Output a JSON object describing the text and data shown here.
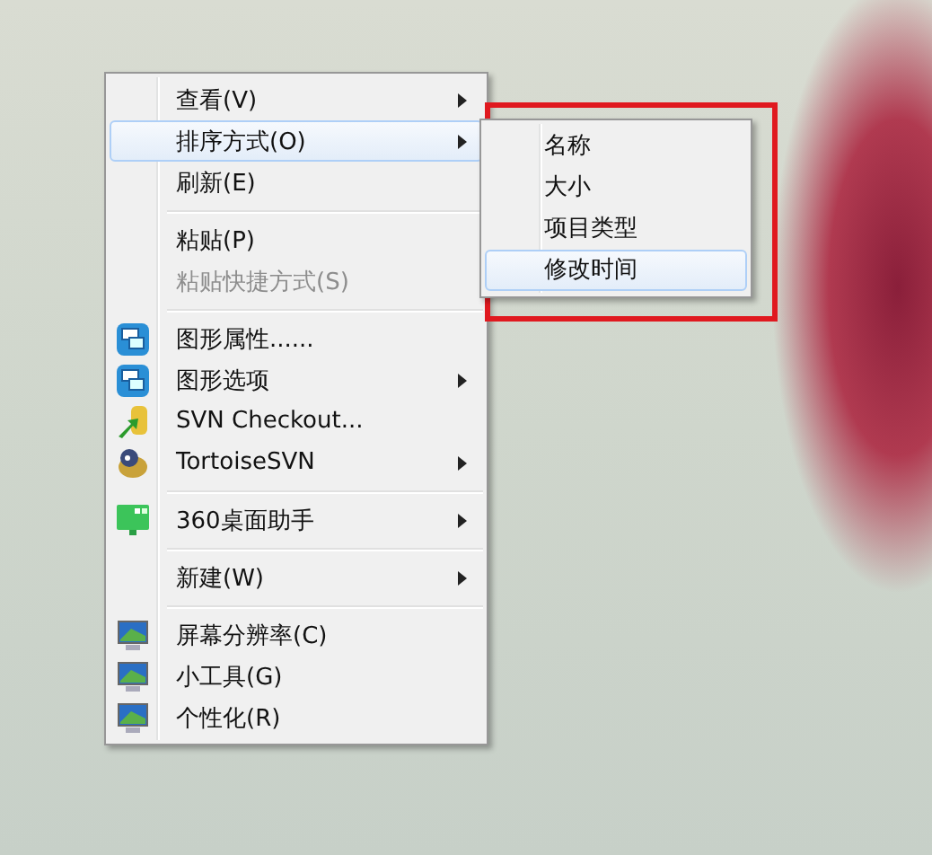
{
  "context_menu": {
    "items": [
      {
        "kind": "item",
        "label": "查看(V)",
        "has_submenu": true,
        "selected": false,
        "disabled": false
      },
      {
        "kind": "item",
        "label": "排序方式(O)",
        "has_submenu": true,
        "selected": true,
        "disabled": false
      },
      {
        "kind": "item",
        "label": "刷新(E)",
        "has_submenu": false,
        "selected": false,
        "disabled": false
      },
      {
        "kind": "separator"
      },
      {
        "kind": "item",
        "label": "粘贴(P)",
        "has_submenu": false,
        "selected": false,
        "disabled": false
      },
      {
        "kind": "item",
        "label": "粘贴快捷方式(S)",
        "has_submenu": false,
        "selected": false,
        "disabled": true
      },
      {
        "kind": "separator"
      },
      {
        "kind": "item",
        "label": "图形属性......",
        "has_submenu": false,
        "selected": false,
        "disabled": false
      },
      {
        "kind": "item",
        "label": "图形选项",
        "has_submenu": true,
        "selected": false,
        "disabled": false
      },
      {
        "kind": "item",
        "label": "SVN Checkout...",
        "has_submenu": false,
        "selected": false,
        "disabled": false
      },
      {
        "kind": "item",
        "label": "TortoiseSVN",
        "has_submenu": true,
        "selected": false,
        "disabled": false
      },
      {
        "kind": "separator"
      },
      {
        "kind": "item",
        "label": "360桌面助手",
        "has_submenu": true,
        "selected": false,
        "disabled": false
      },
      {
        "kind": "separator"
      },
      {
        "kind": "item",
        "label": "新建(W)",
        "has_submenu": true,
        "selected": false,
        "disabled": false
      },
      {
        "kind": "separator"
      },
      {
        "kind": "item",
        "label": "屏幕分辨率(C)",
        "has_submenu": false,
        "selected": false,
        "disabled": false
      },
      {
        "kind": "item",
        "label": "小工具(G)",
        "has_submenu": false,
        "selected": false,
        "disabled": false
      },
      {
        "kind": "item",
        "label": "个性化(R)",
        "has_submenu": false,
        "selected": false,
        "disabled": false
      }
    ]
  },
  "submenu": {
    "items": [
      {
        "label": "名称",
        "selected": false
      },
      {
        "label": "大小",
        "selected": false
      },
      {
        "label": "项目类型",
        "selected": false
      },
      {
        "label": "修改时间",
        "selected": true
      }
    ]
  }
}
